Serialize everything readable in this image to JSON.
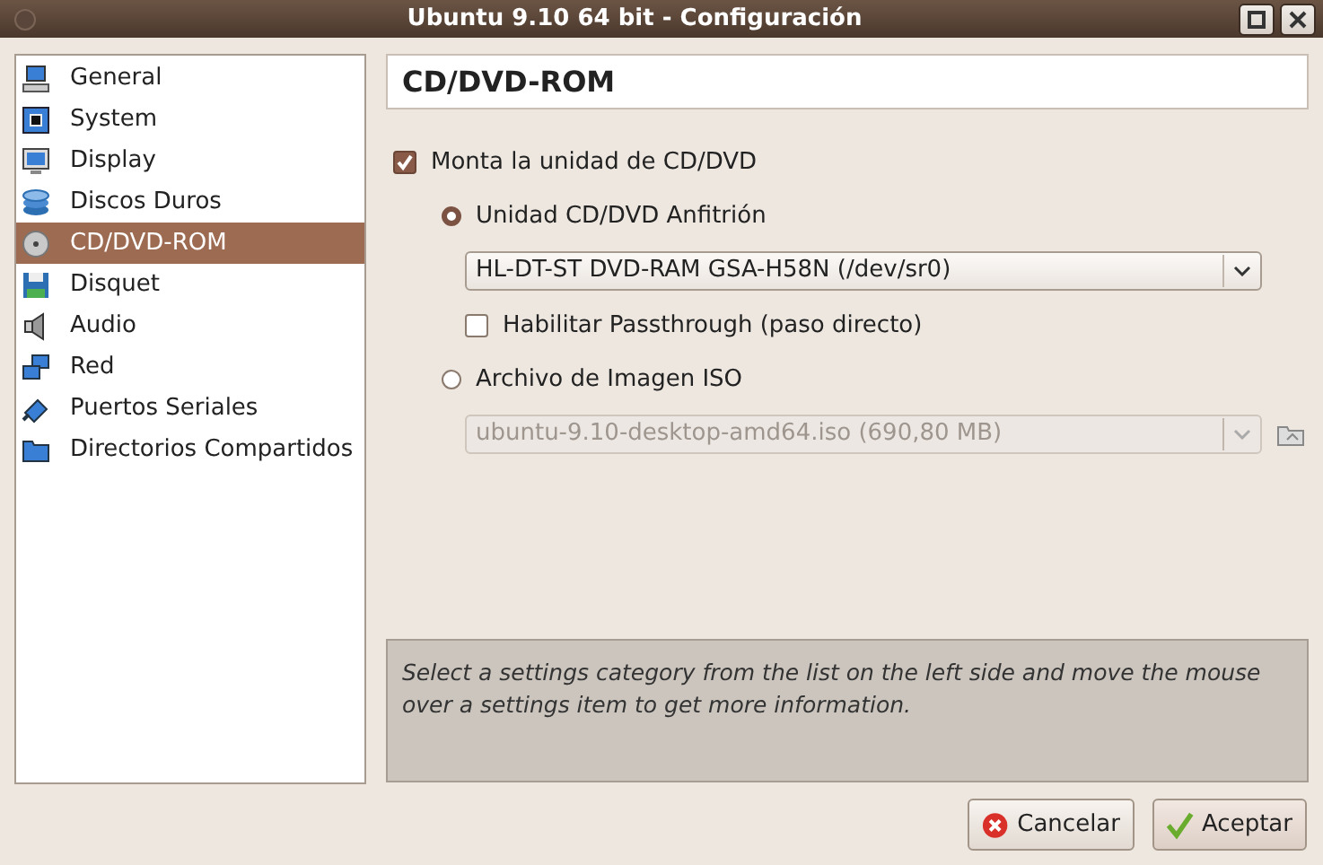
{
  "window": {
    "title": "Ubuntu 9.10 64 bit - Configuración"
  },
  "sidebar": {
    "items": [
      {
        "label": "General",
        "selected": false
      },
      {
        "label": "System",
        "selected": false
      },
      {
        "label": "Display",
        "selected": false
      },
      {
        "label": "Discos Duros",
        "selected": false
      },
      {
        "label": "CD/DVD-ROM",
        "selected": true
      },
      {
        "label": "Disquet",
        "selected": false
      },
      {
        "label": "Audio",
        "selected": false
      },
      {
        "label": "Red",
        "selected": false
      },
      {
        "label": "Puertos Seriales",
        "selected": false
      },
      {
        "label": "Directorios Compartidos",
        "selected": false
      }
    ]
  },
  "page": {
    "title": "CD/DVD-ROM",
    "mount": {
      "label": "Monta la unidad de CD/DVD",
      "checked": true
    },
    "host": {
      "label": "Unidad CD/DVD Anfitrión",
      "selected": true,
      "value": "HL-DT-ST DVD-RAM GSA-H58N (/dev/sr0)",
      "disabled": false,
      "passthrough": {
        "label": "Habilitar Passthrough (paso directo)",
        "checked": false
      }
    },
    "iso": {
      "label": "Archivo de Imagen ISO",
      "selected": false,
      "value": "ubuntu-9.10-desktop-amd64.iso (690,80 MB)",
      "disabled": true
    },
    "info": "Select a settings category from the list on the left side and move the mouse over a settings item to get more information."
  },
  "buttons": [
    {
      "label": "Cancelar",
      "kind": "cancel"
    },
    {
      "label": "Aceptar",
      "kind": "ok"
    }
  ]
}
